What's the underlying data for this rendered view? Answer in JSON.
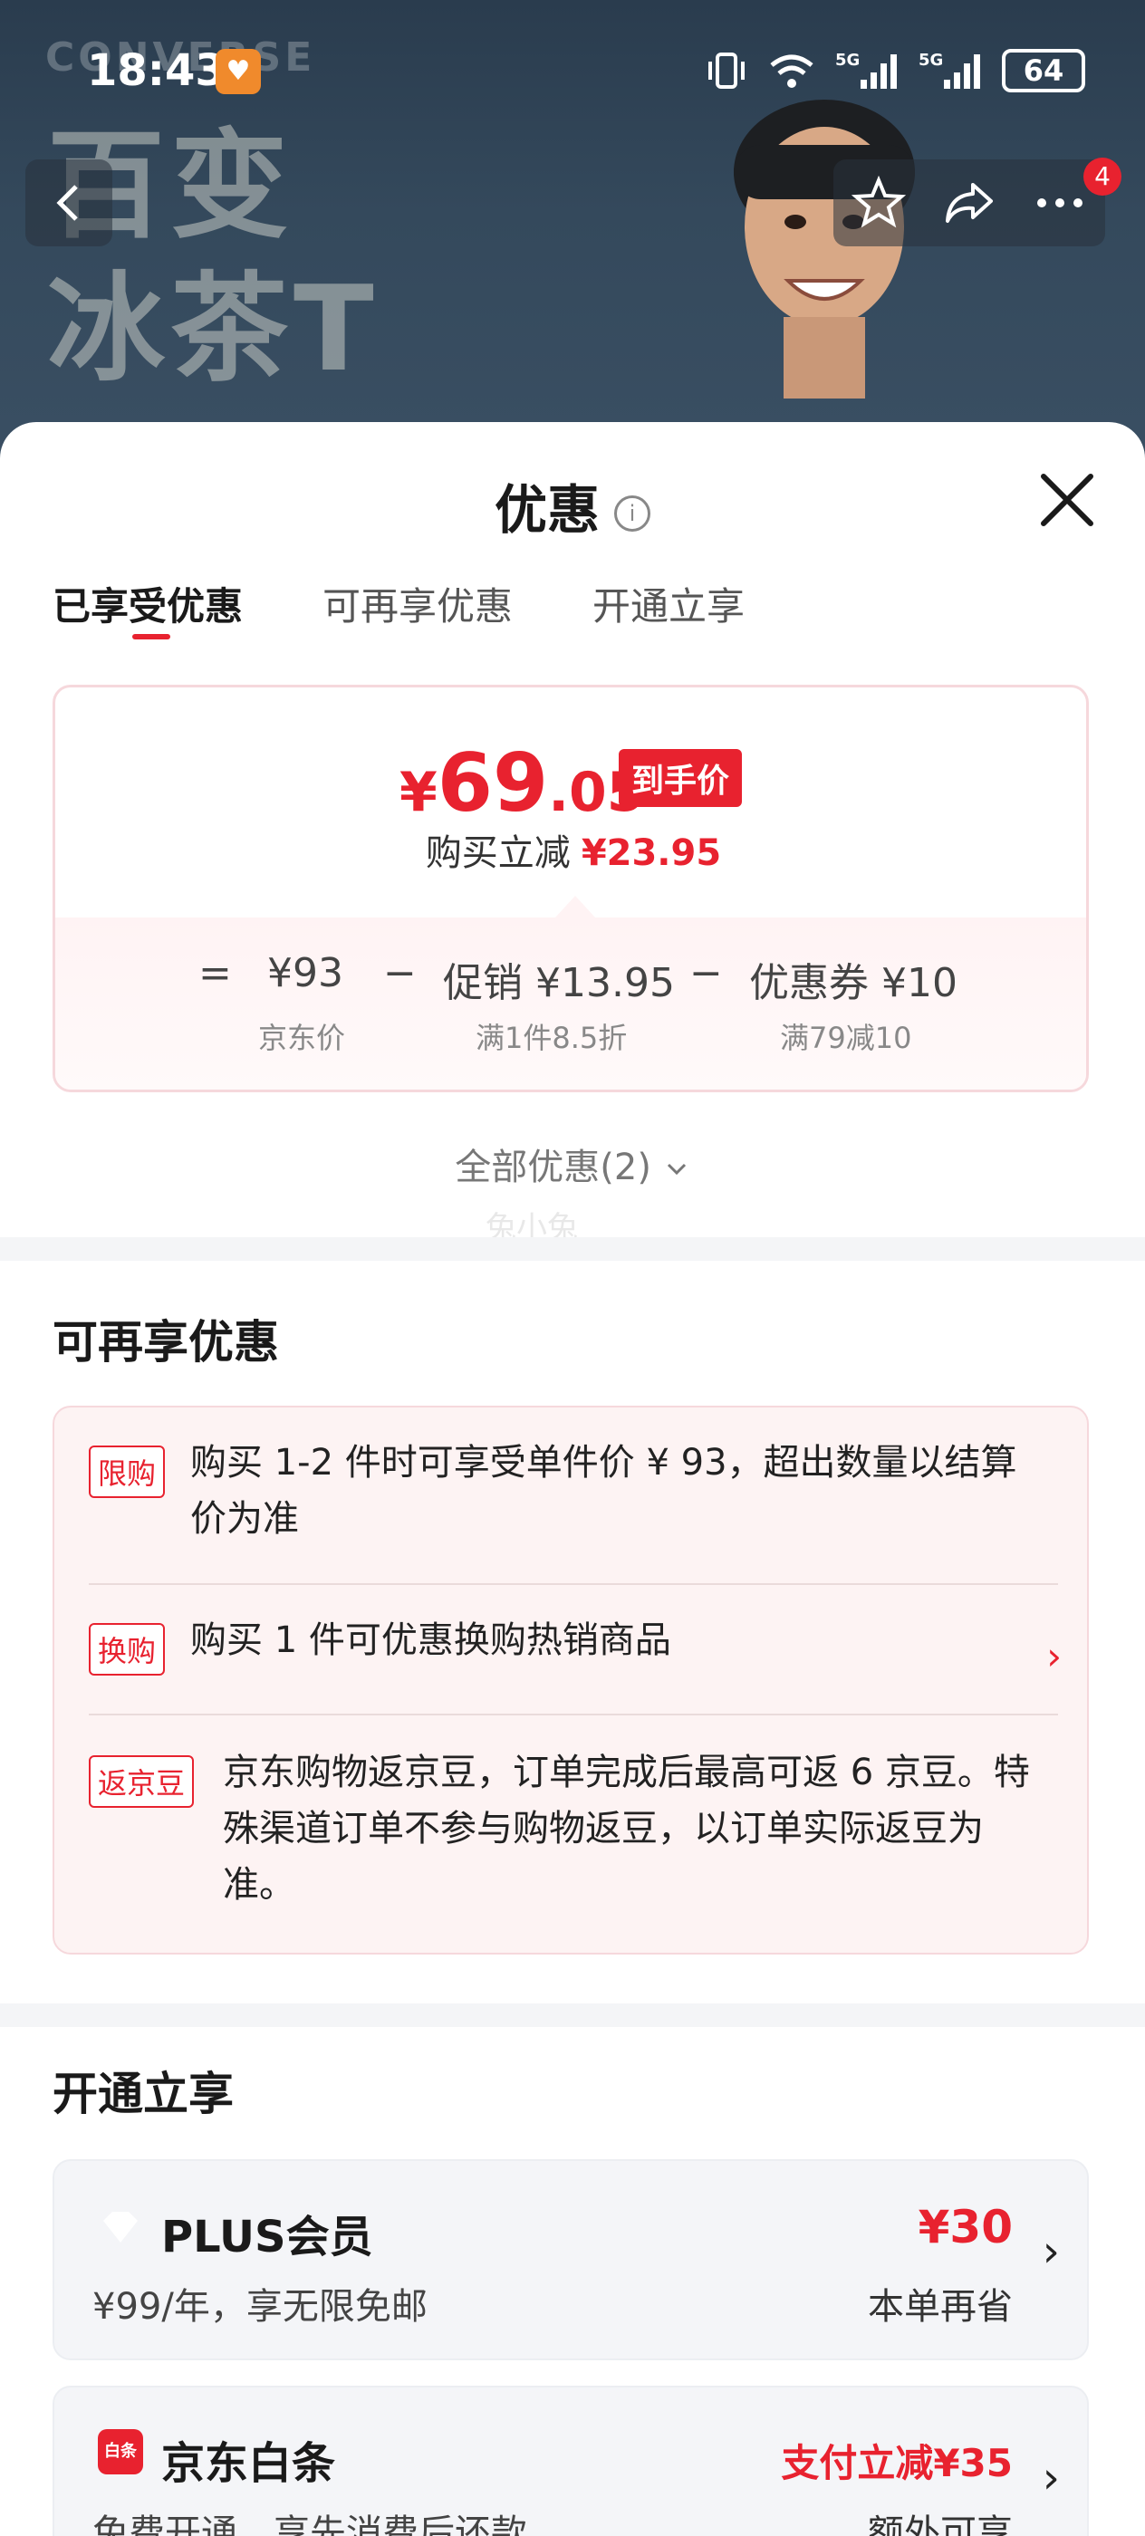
{
  "status_bar": {
    "time": "18:43",
    "battery": "64"
  },
  "hero": {
    "brand_text": "CONVERSE",
    "headline_line1": "百变",
    "headline_line2": "冰茶T"
  },
  "nav": {
    "badge_count": "4"
  },
  "sheet": {
    "title": "优惠",
    "info_glyph": "i",
    "tabs": [
      "已享受优惠",
      "可再享优惠",
      "开通立享"
    ]
  },
  "price_card": {
    "currency": "¥",
    "price_int": "69",
    "price_dec": ".05",
    "tag": "到手价",
    "reduce_label": "购买立减",
    "reduce_value": "¥23.95",
    "formula": {
      "eq": "=",
      "base": "¥93",
      "minus": "−",
      "promo": "促销 ¥13.95",
      "coupon": "优惠券 ¥10",
      "base_sub": "京东价",
      "promo_sub": "满1件8.5折",
      "coupon_sub": "满79减10"
    }
  },
  "all_promos": "全部优惠(2)",
  "watermark": "兔小兔",
  "more_offers": {
    "title": "可再享优惠",
    "items": [
      {
        "tag": "限购",
        "line1": "购买 1-2 件时可享受单件价 ¥ 93，超出数量以结算",
        "line2": "价为准",
        "line3": ""
      },
      {
        "tag": "换购",
        "line1": "购买 1 件可优惠换购热销商品",
        "line2": "",
        "line3": ""
      },
      {
        "tag": "返京豆",
        "line1": "京东购物返京豆，订单完成后最高可返 6 京豆。特",
        "line2": "殊渠道订单不参与购物返豆，以订单实际返豆为",
        "line3": "准。"
      }
    ]
  },
  "open_now": {
    "title": "开通立享",
    "plus": {
      "name": "PLUS会员",
      "desc": "¥99/年，享无限免邮",
      "save": "¥30",
      "extra": "本单再省"
    },
    "baitiao": {
      "name": "京东白条",
      "icon_text": "白条",
      "desc": "免费开通，享先消费后还款",
      "save": "支付立减¥35",
      "extra": "额外可享"
    }
  },
  "colors": {
    "accent": "#e8222f",
    "card_bg": "#fdf3f3",
    "sheet_bg": "#ffffff"
  }
}
